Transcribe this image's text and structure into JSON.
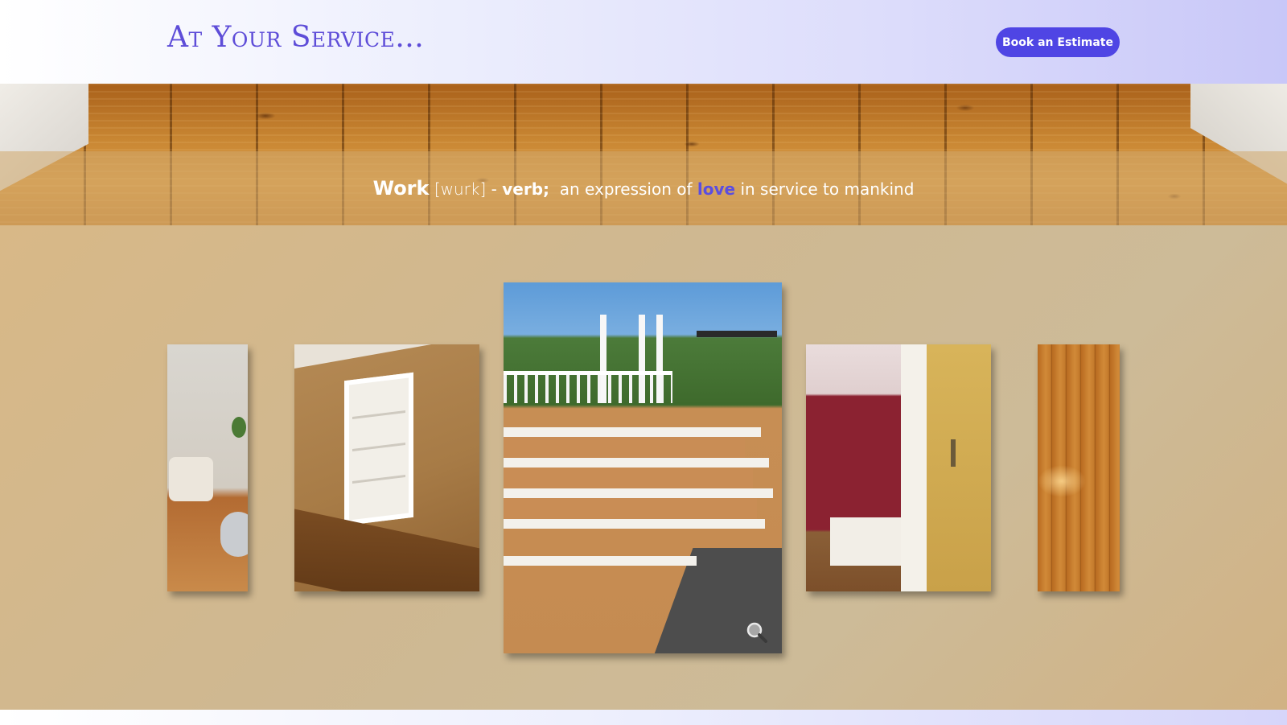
{
  "header": {
    "title": "At Your Service...",
    "cta_label": "Book an Estimate"
  },
  "hero": {
    "tagline": {
      "word": "Work",
      "phonetic": "[wurk]",
      "dash": " - ",
      "part_of_speech": "verb;",
      "definition_before": "an expression of",
      "highlight": "love",
      "definition_after": "in service to mankind"
    }
  },
  "gallery": {
    "icons": {
      "zoom": "magnifier-icon"
    }
  },
  "colors": {
    "accent": "#4f45e4",
    "title": "#5e4dd8",
    "highlight": "#5b4ee0",
    "gallery_bg": "#d1b88d"
  }
}
